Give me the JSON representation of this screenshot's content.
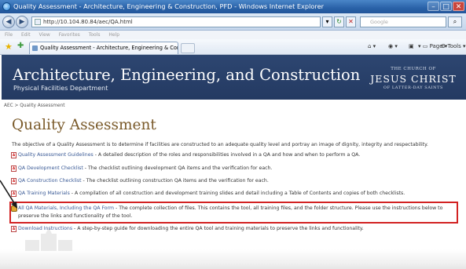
{
  "window": {
    "title": "Quality Assessment - Architecture, Engineering & Construction, PFD - Windows Internet Explorer",
    "min_label": "–",
    "max_label": "□",
    "close_label": "✕"
  },
  "address": {
    "url": "http://10.104.80.84/aec/QA.html",
    "search_placeholder": "Google"
  },
  "menu": [
    "File",
    "Edit",
    "View",
    "Favorites",
    "Tools",
    "Help"
  ],
  "tab": {
    "label": "Quality Assessment - Architecture, Engineering & Con..."
  },
  "commands": {
    "page": "Page",
    "tools": "Tools"
  },
  "banner": {
    "title": "Architecture, Engineering, and Construction",
    "subtitle": "Physical Facilities Department",
    "logo_top": "THE CHURCH OF",
    "logo_main": "JESUS CHRIST",
    "logo_bottom": "OF LATTER-DAY SAINTS"
  },
  "breadcrumb": "AEC > Quality Assessment",
  "heading": "Quality Assessment",
  "intro": "The objective of a Quality Assessment is to determine if facilities are constructed to an adequate quality level and portray an image of dignity, integrity and respectability.",
  "items": [
    {
      "link": "Quality Assessment Guidelines",
      "desc": " - A detailed description of the roles and responsibilities involved in a QA and how and when to perform a QA."
    },
    {
      "link": "QA Development Checklist",
      "desc": " - The checklist outlining development QA items and the verification for each."
    },
    {
      "link": "QA Construction Checklist",
      "desc": " - The checklist outlining construction QA items and the verification for each."
    },
    {
      "link": "QA Training Materials",
      "desc": " - A compilation of all construction and development training slides and detail including a Table of Contents and copies of both checklists."
    },
    {
      "link": "All QA Materials, Including the QA Form",
      "desc": " - The complete collection of files. This contains the tool, all training files, and the folder structure. Please use the instructions below to preserve the links and functionality of the tool."
    },
    {
      "link": "Download Instructions",
      "desc": " - A step-by-step guide for downloading the entire QA tool and training materials to preserve the links and functionality."
    }
  ],
  "colors": {
    "banner": "#2d4671",
    "link": "#3a5a96",
    "heading": "#7a5a2a",
    "highlight": "#d22222"
  }
}
